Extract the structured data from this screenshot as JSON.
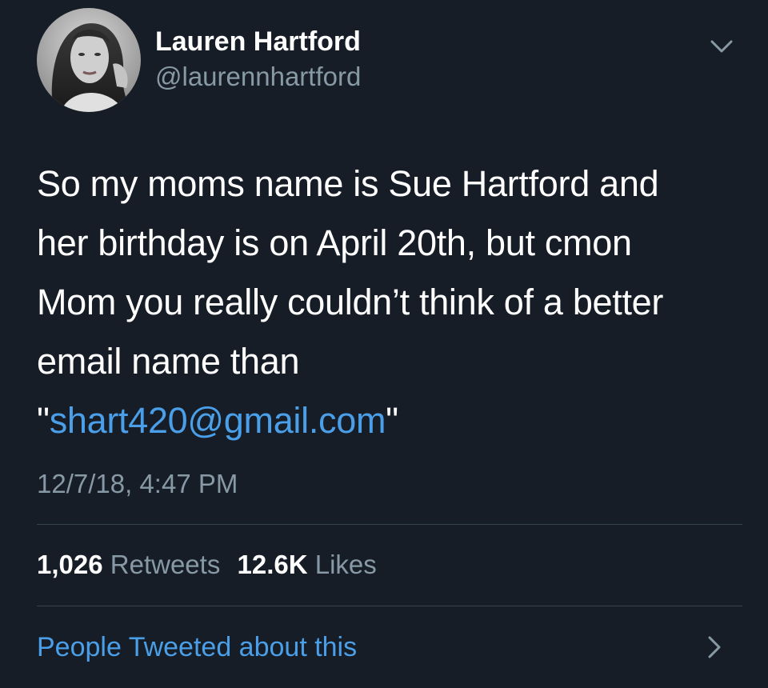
{
  "author": {
    "display_name": "Lauren Hartford",
    "handle": "@laurennhartford"
  },
  "tweet": {
    "text_lines": [
      "So my moms name is Sue Hartford and",
      "her birthday is on April 20th, but cmon",
      "Mom you really couldn’t think of a better",
      "email name than"
    ],
    "quote_open": "\"",
    "email": "shart420@gmail.com",
    "quote_close": "\"",
    "timestamp": "12/7/18, 4:47 PM"
  },
  "stats": {
    "retweets_count": "1,026",
    "retweets_label": "Retweets",
    "likes_count": "12.6K",
    "likes_label": "Likes"
  },
  "footer": {
    "people_tweeted_label": "People Tweeted about this"
  },
  "icons": {
    "menu": "chevron-down-icon",
    "footer_arrow": "chevron-right-icon"
  },
  "colors": {
    "background": "#161d27",
    "link": "#4a9fe8",
    "secondary_text": "#8899a6",
    "divider": "#38444d"
  }
}
